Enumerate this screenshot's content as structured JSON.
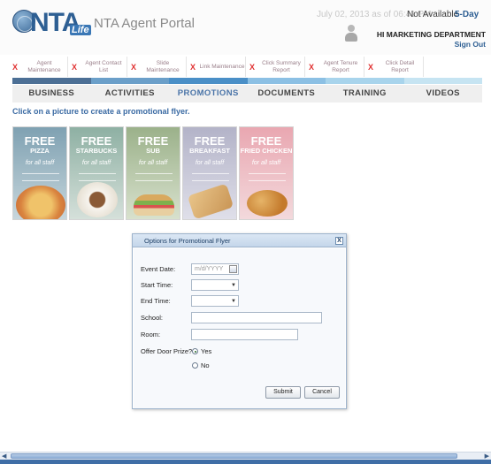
{
  "header": {
    "logo_text": "NTA",
    "logo_suffix": "Life",
    "portal_title": "NTA Agent Portal",
    "datetime": "July 02, 2013 as of 06:41 PM",
    "availability": "Not Available",
    "day_range": "5-Day",
    "department": "HI MARKETING DEPARTMENT",
    "signout": "Sign Out"
  },
  "quick_links": [
    {
      "label": "Agent Maintenance"
    },
    {
      "label": "Agent Contact List"
    },
    {
      "label": "Slide Maintenance"
    },
    {
      "label": "Link Maintenance"
    },
    {
      "label": "Click Summary Report"
    },
    {
      "label": "Agent Tenure Report"
    },
    {
      "label": "Click Detail Report"
    }
  ],
  "quick_link_close": "X",
  "stripe_colors": [
    "#4c6f95",
    "#6b9fc9",
    "#4a8fc7",
    "#8cc0e4",
    "#a8d4ec",
    "#c6e4f2"
  ],
  "tabs": [
    {
      "label": "BUSINESS"
    },
    {
      "label": "ACTIVITIES"
    },
    {
      "label": "PROMOTIONS"
    },
    {
      "label": "DOCUMENTS"
    },
    {
      "label": "TRAINING"
    },
    {
      "label": "VIDEOS"
    }
  ],
  "active_tab": "PROMOTIONS",
  "instruction": "Click on a picture to create a promotional flyer.",
  "flyers": [
    {
      "free": "FREE",
      "item": "PIZZA",
      "staff": "for all staff"
    },
    {
      "free": "FREE",
      "item": "STARBUCKS",
      "staff": "for all staff"
    },
    {
      "free": "FREE",
      "item": "SUB",
      "staff": "for all staff"
    },
    {
      "free": "FREE",
      "item": "BREAKFAST",
      "staff": "for all staff"
    },
    {
      "free": "FREE",
      "item": "FRIED CHICKEN",
      "staff": "for all staff"
    }
  ],
  "dialog": {
    "title": "Options for Promotional Flyer",
    "close": "X",
    "fields": {
      "event_date_label": "Event Date:",
      "event_date_placeholder": "m/d/YYYY",
      "start_time_label": "Start Time:",
      "end_time_label": "End Time:",
      "school_label": "School:",
      "room_label": "Room:",
      "door_prize_label": "Offer Door Prize?:",
      "door_prize_yes": "Yes",
      "door_prize_no": "No",
      "door_prize_selected": "Yes"
    },
    "submit": "Submit",
    "cancel": "Cancel"
  }
}
